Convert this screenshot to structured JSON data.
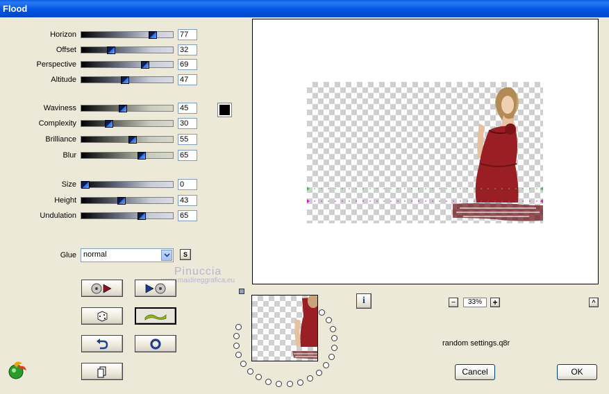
{
  "window": {
    "title": "Flood"
  },
  "sliders": [
    {
      "id": "horizon",
      "label": "Horizon",
      "value": "77",
      "fraction": 0.77,
      "style": ""
    },
    {
      "id": "offset",
      "label": "Offset",
      "value": "32",
      "fraction": 0.32,
      "style": ""
    },
    {
      "id": "perspective",
      "label": "Perspective",
      "value": "69",
      "fraction": 0.69,
      "style": ""
    },
    {
      "id": "altitude",
      "label": "Altitude",
      "value": "47",
      "fraction": 0.47,
      "style": ""
    },
    {
      "id": "waviness",
      "label": "Waviness",
      "value": "45",
      "fraction": 0.45,
      "style": "alt"
    },
    {
      "id": "complexity",
      "label": "Complexity",
      "value": "30",
      "fraction": 0.3,
      "style": "alt"
    },
    {
      "id": "brilliance",
      "label": "Brilliance",
      "value": "55",
      "fraction": 0.55,
      "style": "alt"
    },
    {
      "id": "blur",
      "label": "Blur",
      "value": "65",
      "fraction": 0.65,
      "style": "alt"
    },
    {
      "id": "size",
      "label": "Size",
      "value": "0",
      "fraction": 0.0,
      "style": ""
    },
    {
      "id": "height",
      "label": "Height",
      "value": "43",
      "fraction": 0.43,
      "style": ""
    },
    {
      "id": "undulation",
      "label": "Undulation",
      "value": "65",
      "fraction": 0.65,
      "style": ""
    }
  ],
  "color_swatch": {
    "color": "#000000"
  },
  "glue": {
    "label": "Glue",
    "selected": "normal",
    "s_button": "S"
  },
  "watermark": {
    "line1": "Pinuccia",
    "line2": "www.maidireggrafica.eu"
  },
  "preview": {
    "zoom": "33%",
    "zoom_minus": "−",
    "zoom_plus": "+",
    "collapse": "^"
  },
  "info_button": {
    "label": "i"
  },
  "random_settings": "random settings.q8r",
  "buttons": {
    "cancel": "Cancel",
    "ok": "OK"
  },
  "colors": {
    "accent_green": "#46c046",
    "accent_magenta": "#d020d0",
    "dress": "#9a1f24"
  }
}
